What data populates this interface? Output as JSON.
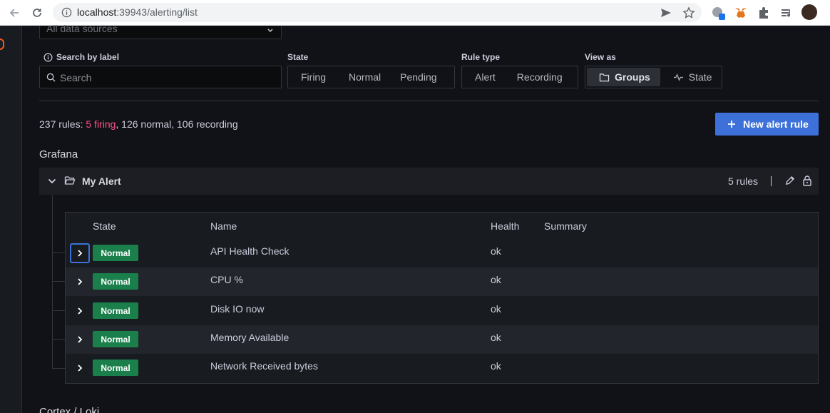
{
  "browser": {
    "url_host": "localhost",
    "url_rest": ":39943/alerting/list",
    "icons": [
      "back-icon",
      "reload-icon",
      "info-icon",
      "send-icon",
      "star-icon",
      "extension-icon",
      "metamask-icon",
      "puzzle-icon",
      "media-icon",
      "profile-avatar"
    ]
  },
  "filters": {
    "datasource_placeholder": "All data sources",
    "search_label": "Search by label",
    "search_placeholder": "Search",
    "state_label": "State",
    "state_options": [
      "Firing",
      "Normal",
      "Pending"
    ],
    "rule_type_label": "Rule type",
    "rule_type_options": [
      "Alert",
      "Recording"
    ],
    "view_as_label": "View as",
    "view_options": [
      "Groups",
      "State"
    ],
    "view_selected": "Groups"
  },
  "summary": {
    "total": "237 rules: ",
    "firing": "5 firing",
    "rest": ", 126 normal, 106 recording"
  },
  "new_rule_button": "New alert rule",
  "namespaces": [
    {
      "title": "Grafana",
      "groups": [
        {
          "name": "My Alert",
          "rule_count": "5 rules",
          "columns": [
            "State",
            "Name",
            "Health",
            "Summary"
          ],
          "rules": [
            {
              "state": "Normal",
              "name": "API Health Check",
              "health": "ok",
              "summary": ""
            },
            {
              "state": "Normal",
              "name": "CPU %",
              "health": "ok",
              "summary": ""
            },
            {
              "state": "Normal",
              "name": "Disk IO now",
              "health": "ok",
              "summary": ""
            },
            {
              "state": "Normal",
              "name": "Memory Available",
              "health": "ok",
              "summary": ""
            },
            {
              "state": "Normal",
              "name": "Network Received bytes",
              "health": "ok",
              "summary": ""
            }
          ]
        }
      ]
    },
    {
      "title": "Cortex / Loki"
    }
  ],
  "colors": {
    "accent": "#3d71d9",
    "firing": "#ff5286",
    "normal_badge": "#1a7f4b",
    "background": "#111217"
  }
}
